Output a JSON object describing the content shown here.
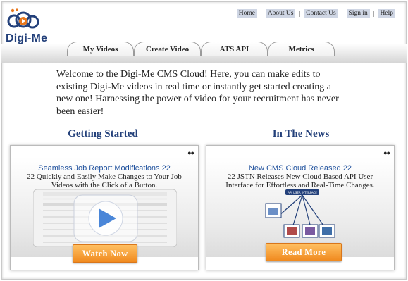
{
  "brand": {
    "name": "Digi-Me"
  },
  "top_links": [
    "Home",
    "About Us",
    "Contact Us",
    "Sign in",
    "Help"
  ],
  "tabs": [
    "My Videos",
    "Create Video",
    "ATS API",
    "Metrics"
  ],
  "welcome": "Welcome to the Digi-Me CMS Cloud! Here, you can make edits to existing Digi-Me videos in real time or instantly get started creating a new one! Harnessing the power of video for your recruitment has never been easier!",
  "sections": {
    "left": {
      "title": "Getting Started",
      "headline": "Seamless Job Report Modifications 22",
      "subtitle": "22 Quickly and Easily Make Changes to Your Job Videos with the Click of a Button.",
      "button": "Watch Now"
    },
    "right": {
      "title": "In The News",
      "headline": "New CMS Cloud Released 22",
      "subtitle": "22 JSTN Releases New Cloud Based API User Interface for Effortless and Real-Time Changes.",
      "button": "Read More",
      "diagram_label": "API USER INTERFACE"
    }
  },
  "colors": {
    "brand_blue": "#23407a",
    "headline_blue": "#1d4f9c",
    "button_orange": "#f08a1f",
    "play_blue": "#4a86d8"
  },
  "icons": {
    "logo": "play-bubbles-logo",
    "play": "play-icon",
    "menu_dots": "dots-icon"
  }
}
